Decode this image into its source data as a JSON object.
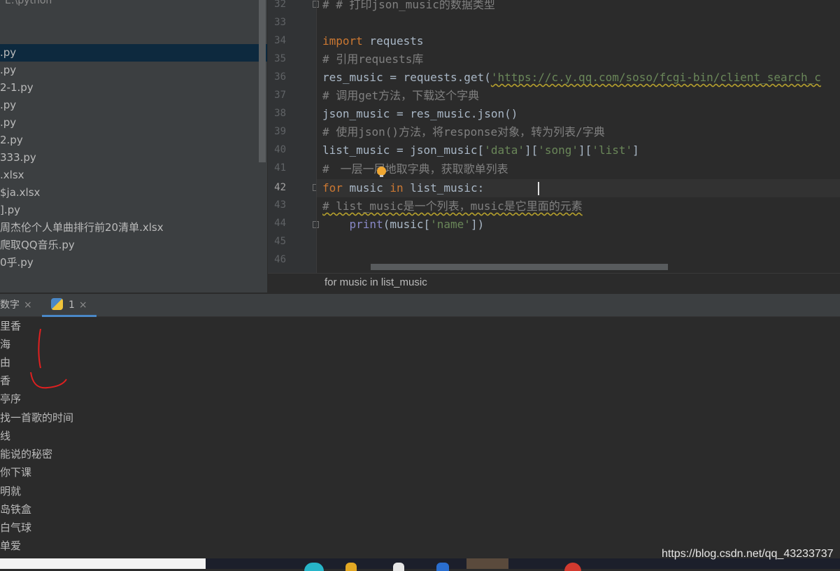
{
  "project": {
    "root_path": "E:\\python",
    "files": [
      ".py",
      ".py",
      "2-1.py",
      ".py",
      ".py",
      "2.py",
      "333.py",
      ".xlsx",
      "$ja.xlsx",
      "].py",
      "周杰伦个人单曲排行前20清单.xlsx",
      "爬取QQ音乐.py",
      "0乎.py"
    ]
  },
  "editor": {
    "line_numbers": [
      "32",
      "33",
      "34",
      "35",
      "36",
      "37",
      "38",
      "39",
      "40",
      "41",
      "42",
      "43",
      "44",
      "45",
      "46"
    ],
    "current_line": "42",
    "code": {
      "l32": "# # 打印json_music的数据类型",
      "l34_kw": "import",
      "l34_rest": " requests",
      "l35": "# 引用requests库",
      "l36_a": "res_music = requests.get(",
      "l36_url": "'https://c.y.qq.com/soso/fcgi-bin/client_search_c",
      "l37": "# 调用get方法，下载这个字典",
      "l38": "json_music = res_music.json()",
      "l39": "# 使用json()方法，将response对象，转为列表/字典",
      "l40_a": "list_music = json_music[",
      "l40_s1": "'data'",
      "l40_b": "][",
      "l40_s2": "'song'",
      "l40_c": "][",
      "l40_s3": "'list'",
      "l40_d": "]",
      "l41_hash": "#",
      "l41_rest": "一层一层地取字典，获取歌单列表",
      "l42_for": "for",
      "l42_a": " music ",
      "l42_in": "in",
      "l42_b": " list_music:",
      "l43": "# list_music是一个列表，music是它里面的元素",
      "l44_indent": "    ",
      "l44_print": "print",
      "l44_a": "(music[",
      "l44_s": "'name'",
      "l44_b": "])"
    },
    "breadcrumb": "for music in list_music"
  },
  "run": {
    "tab1_label": "数字",
    "tab2_label": "1",
    "close_glyph": "×",
    "output": [
      "里香",
      "海",
      "由",
      "香",
      "亭序",
      "找一首歌的时间",
      "线",
      "能说的秘密",
      "你下课",
      "明就",
      "岛铁盒",
      "白气球",
      "单爱"
    ]
  },
  "watermark": "https://blog.csdn.net/qq_43233737",
  "colors": {
    "keyword": "#cc7832",
    "comment": "#808080",
    "string": "#6a8759",
    "builtin": "#8888c6",
    "annotation": "#e02020"
  },
  "icons": [
    "python-icon",
    "bulb-icon",
    "close-icon"
  ]
}
